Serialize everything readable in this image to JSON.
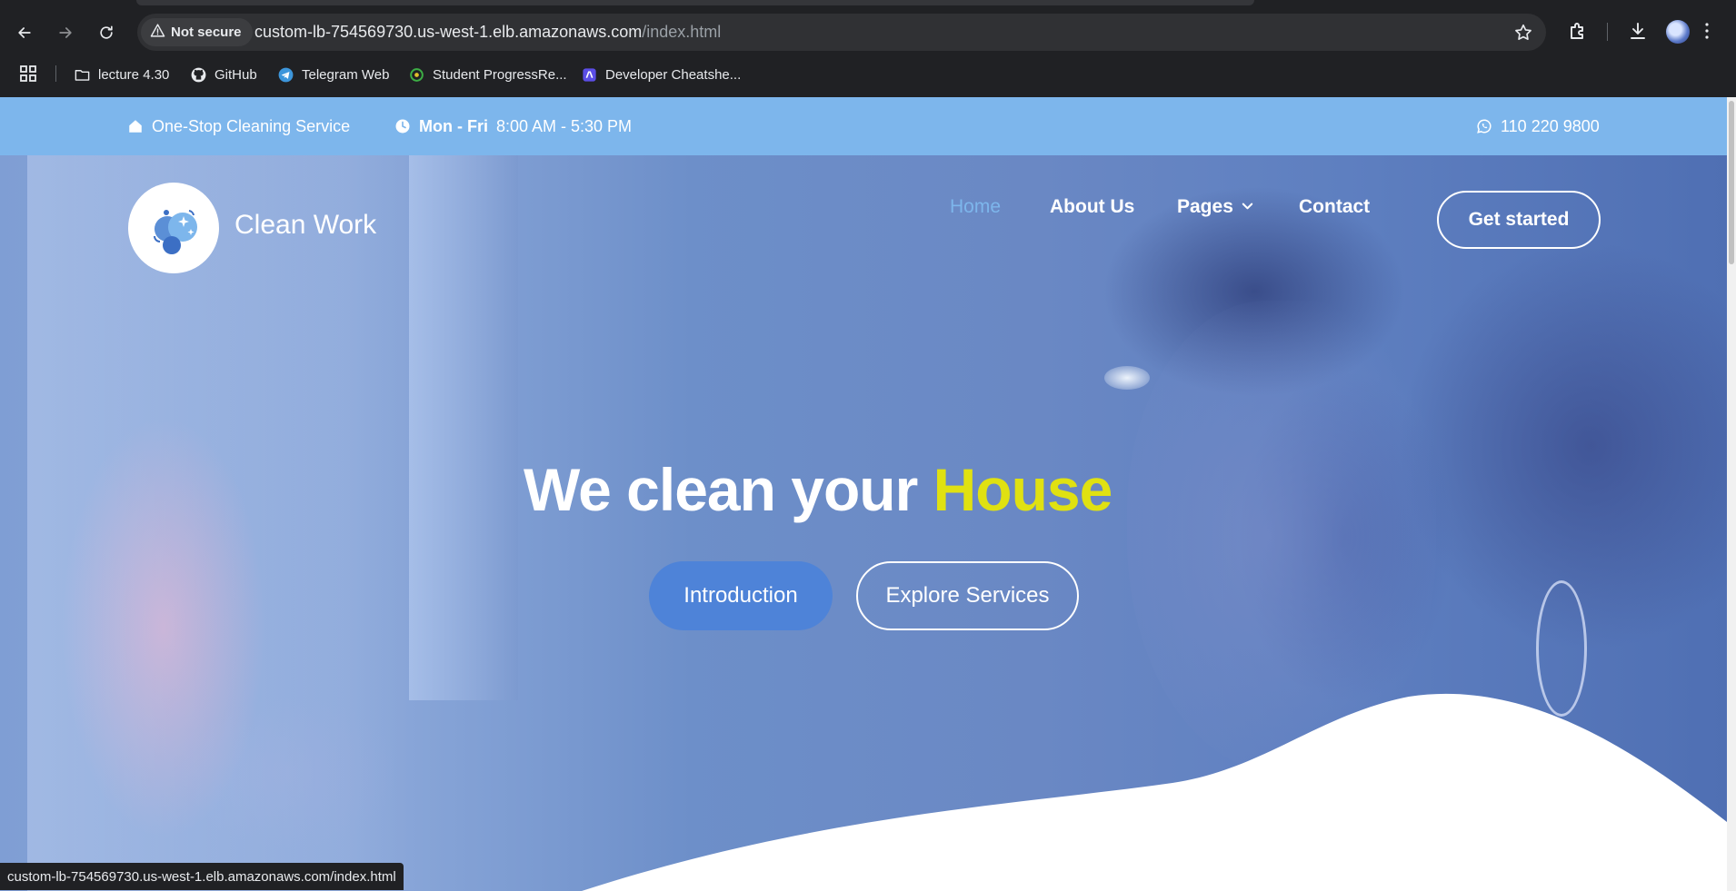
{
  "browser": {
    "security_label": "Not secure",
    "url_host": "custom-lb-754569730.us-west-1.elb.amazonaws.com",
    "url_path": "/index.html",
    "status_url": "custom-lb-754569730.us-west-1.elb.amazonaws.com/index.html",
    "bookmarks": [
      {
        "label": "lecture 4.30",
        "icon": "folder-icon"
      },
      {
        "label": "GitHub",
        "icon": "github-icon"
      },
      {
        "label": "Telegram Web",
        "icon": "telegram-icon"
      },
      {
        "label": "Student ProgressRe...",
        "icon": "progress-icon"
      },
      {
        "label": "Developer Cheatshe...",
        "icon": "cheatsheet-icon"
      }
    ]
  },
  "topbar": {
    "tagline": "One-Stop Cleaning Service",
    "hours_days": "Mon - Fri",
    "hours_time": "8:00 AM - 5:30 PM",
    "phone": "110 220 9800"
  },
  "header": {
    "brand": "Clean Work",
    "nav": {
      "home": "Home",
      "about": "About Us",
      "pages": "Pages",
      "contact": "Contact"
    },
    "cta": "Get started"
  },
  "hero": {
    "title_main": "We clean your",
    "title_accent": "House",
    "primary_button": "Introduction",
    "secondary_button": "Explore Services"
  },
  "colors": {
    "topbar_bg": "#7db6ec",
    "accent_yellow": "#e0e111",
    "primary_button": "#4e83d8",
    "active_nav": "#7db6ec"
  }
}
